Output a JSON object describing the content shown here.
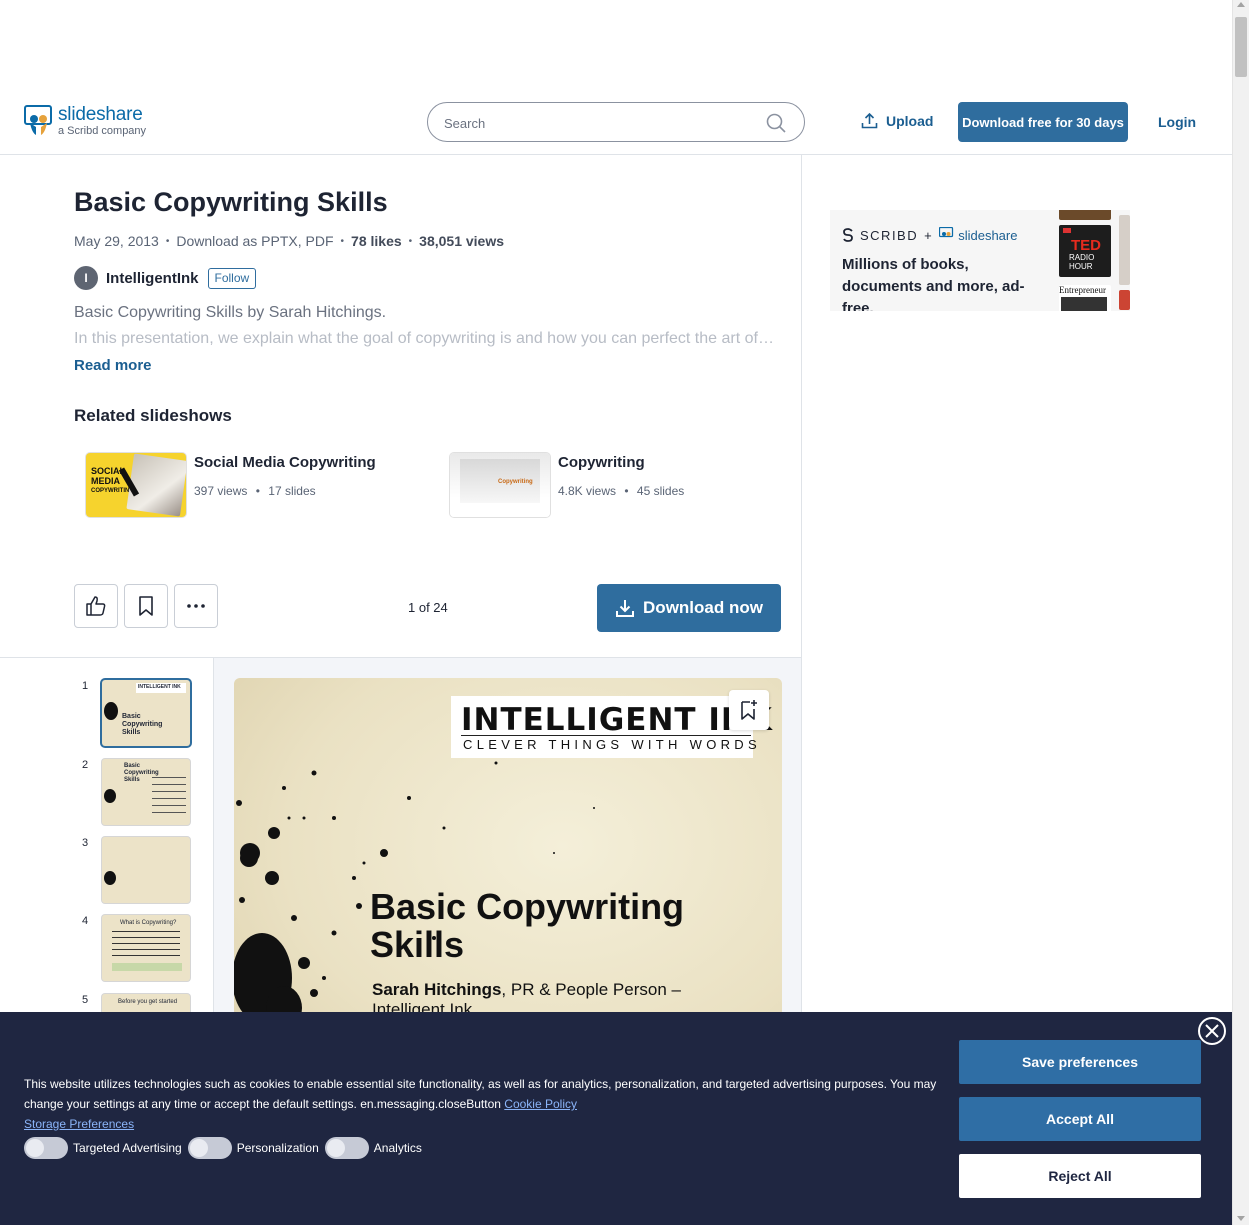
{
  "header": {
    "logo_name": "slideshare",
    "logo_sub": "a Scribd company",
    "search_placeholder": "Search",
    "upload_label": "Upload",
    "download_free_label": "Download free for 30 days",
    "login_label": "Login"
  },
  "doc": {
    "title": "Basic Copywriting Skills",
    "date": "May 29, 2013",
    "download_as": "Download as PPTX, PDF",
    "likes": "78 likes",
    "views": "38,051 views",
    "author_initial": "I",
    "author": "IntelligentInk",
    "follow_label": "Follow",
    "description_line1": "Basic Copywriting Skills by Sarah Hitchings.",
    "description_line2": "In this presentation, we explain what the goal of copywriting is and how you can perfect the art of copywriting...",
    "read_more": "Read more"
  },
  "related": {
    "heading": "Related slideshows",
    "items": [
      {
        "title": "Social Media Copywriting",
        "views": "397 views",
        "slides": "17 slides",
        "thumb_text": [
          "SOCIAL",
          "MEDIA",
          "COPYWRITING"
        ]
      },
      {
        "title": "Copywriting",
        "views": "4.8K views",
        "slides": "45 slides",
        "thumb_text": [
          "Copywriting"
        ]
      }
    ]
  },
  "toolbar": {
    "page_indicator": "1 of 24",
    "download_now": "Download now"
  },
  "thumbnails": [
    {
      "num": "1",
      "title": "Basic Copywriting Skills",
      "brand": "INTELLIGENT INK"
    },
    {
      "num": "2",
      "title": "Basic Copywriting Skills"
    },
    {
      "num": "3",
      "title": ""
    },
    {
      "num": "4",
      "title": "What is Copywriting?"
    },
    {
      "num": "5",
      "title": "Before you get started"
    }
  ],
  "slide": {
    "brand_line1": "INTELLIGENT INK",
    "brand_line2": "CLEVER THINGS WITH WORDS",
    "title_line1": "Basic Copywriting",
    "title_line2": "Skills",
    "presenter_name": "Sarah Hitchings",
    "presenter_role": ", PR & People Person –",
    "presenter_company": "Intelligent Ink"
  },
  "ad": {
    "brand1": "SCRIBD",
    "plus": "+",
    "brand2": "slideshare",
    "text": "Millions of books, documents and more, ad-free.",
    "book_text": [
      "TED",
      "RADIO",
      "HOUR",
      "Entrepreneur"
    ]
  },
  "cookie": {
    "text": "This website utilizes technologies such as cookies to enable essential site functionality, as well as for analytics, personalization, and targeted advertising purposes. You may change your settings at any time or accept the default settings. en.messaging.closeButton",
    "policy_link": "Cookie Policy",
    "storage_link": "Storage Preferences",
    "toggles": [
      "Targeted Advertising",
      "Personalization",
      "Analytics"
    ],
    "save_label": "Save preferences",
    "accept_label": "Accept All",
    "reject_label": "Reject All"
  },
  "colors": {
    "brand_blue": "#2f6d9e",
    "banner_bg": "#1f2641",
    "link_blue": "#1b5e91"
  }
}
